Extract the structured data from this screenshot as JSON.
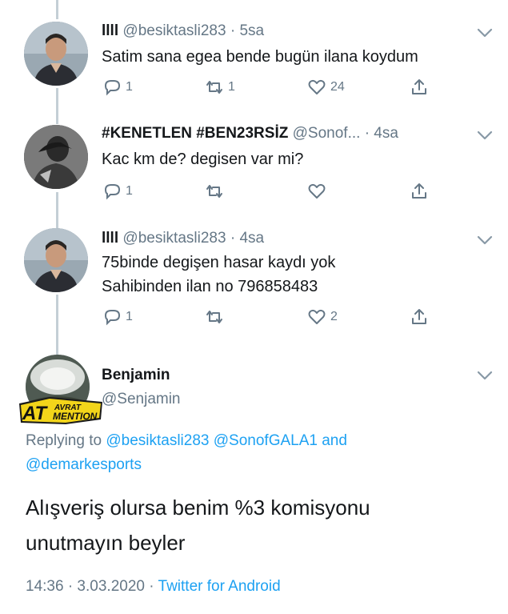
{
  "tweets": [
    {
      "name": "llll",
      "handle": "@besiktasli283",
      "time": "5sa",
      "text_lines": [
        "Satim sana egea bende bugün ilana koydum"
      ],
      "replies": "1",
      "retweets": "1",
      "likes": "24"
    },
    {
      "name": "#KENETLEN #BEN23RSİZ",
      "handle": "@Sonof...",
      "time": "4sa",
      "text_lines": [
        "Kac km de? degisen var mi?"
      ],
      "replies": "1",
      "retweets": "",
      "likes": ""
    },
    {
      "name": "llll",
      "handle": "@besiktasli283",
      "time": "4sa",
      "text_lines": [
        "75binde degişen hasar kaydı yok",
        "Sahibinden ilan no 796858483"
      ],
      "replies": "1",
      "retweets": "",
      "likes": "2"
    }
  ],
  "focus": {
    "name": "Benjamin",
    "handle": "@Senjamin",
    "badge_line1": "AVRAT",
    "badge_line2": "AT",
    "badge_line3": "MENTION",
    "replying_to_label": "Replying to",
    "replying_mentions_1": "@besiktasli283 @SonofGALA1",
    "replying_and": "and",
    "replying_mentions_2": "@demarkesports",
    "text_lines": [
      "Alışveriş olursa benim %3 komisyonu",
      "unutmayın beyler"
    ],
    "timestamp": "14:36 · 3.03.2020 ·",
    "source": "Twitter for Android"
  },
  "colors": {
    "link": "#1da1f2",
    "muted": "#657786",
    "thread_line": "#c4cfd6"
  },
  "icons": [
    "reply-icon",
    "retweet-icon",
    "like-icon",
    "share-icon",
    "chevron-down-icon"
  ]
}
